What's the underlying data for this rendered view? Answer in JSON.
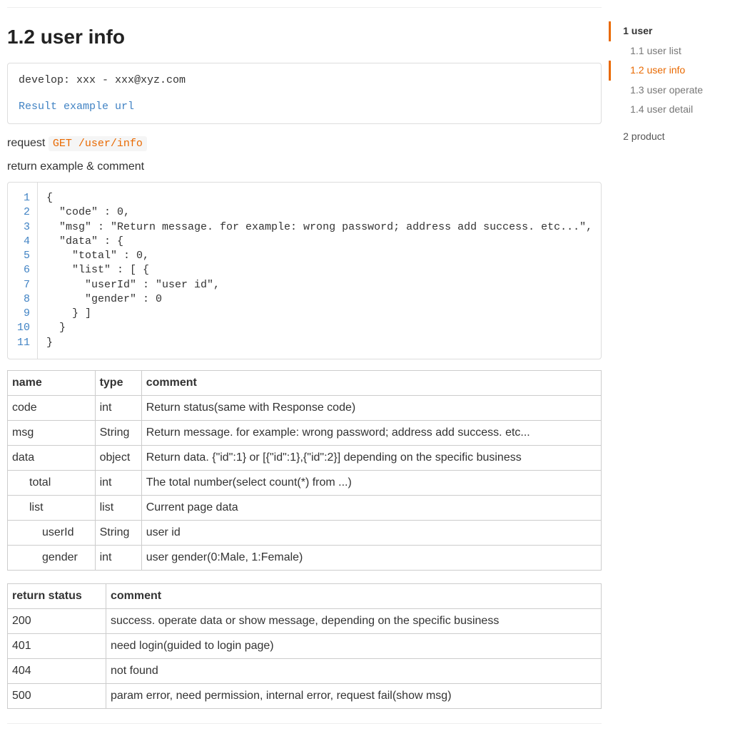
{
  "title": "1.2 user info",
  "dev": {
    "develop_line": "develop: xxx - xxx@xyz.com",
    "result_link": "Result example url"
  },
  "request": {
    "label": "request",
    "method_path": "GET /user/info"
  },
  "return_label": "return example & comment",
  "code": {
    "lines": [
      "1",
      "2",
      "3",
      "4",
      "5",
      "6",
      "7",
      "8",
      "9",
      "10",
      "11"
    ],
    "body": "{\n  \"code\" : 0,\n  \"msg\" : \"Return message. for example: wrong password; address add success. etc...\",\n  \"data\" : {\n    \"total\" : 0,\n    \"list\" : [ {\n      \"userId\" : \"user id\",\n      \"gender\" : 0\n    } ]\n  }\n}"
  },
  "fields_table": {
    "headers": [
      "name",
      "type",
      "comment"
    ],
    "rows": [
      {
        "name": "code",
        "type": "int",
        "comment": "Return status(same with Response code)",
        "indent": 0
      },
      {
        "name": "msg",
        "type": "String",
        "comment": "Return message. for example: wrong password; address add success. etc...",
        "indent": 0
      },
      {
        "name": "data",
        "type": "object",
        "comment": "Return data. {\"id\":1} or [{\"id\":1},{\"id\":2}] depending on the specific business",
        "indent": 0
      },
      {
        "name": "total",
        "type": "int",
        "comment": "The total number(select count(*) from ...)",
        "indent": 1
      },
      {
        "name": "list",
        "type": "list",
        "comment": "Current page data",
        "indent": 1
      },
      {
        "name": "userId",
        "type": "String",
        "comment": "user id",
        "indent": 2
      },
      {
        "name": "gender",
        "type": "int",
        "comment": "user gender(0:Male, 1:Female)",
        "indent": 2
      }
    ]
  },
  "status_table": {
    "headers": [
      "return status",
      "comment"
    ],
    "rows": [
      {
        "status": "200",
        "comment": "success. operate data or show message, depending on the specific business"
      },
      {
        "status": "401",
        "comment": "need login(guided to login page)"
      },
      {
        "status": "404",
        "comment": "not found"
      },
      {
        "status": "500",
        "comment": "param error, need permission, internal error, request fail(show msg)"
      }
    ]
  },
  "toc": [
    {
      "label": "1 user",
      "level": 1,
      "active": true
    },
    {
      "label": "1.1 user list",
      "level": 2,
      "active": false
    },
    {
      "label": "1.2 user info",
      "level": 2,
      "active": true
    },
    {
      "label": "1.3 user operate",
      "level": 2,
      "active": false
    },
    {
      "label": "1.4 user detail",
      "level": 2,
      "active": false
    },
    {
      "label": "2 product",
      "level": 1,
      "active": false
    }
  ]
}
